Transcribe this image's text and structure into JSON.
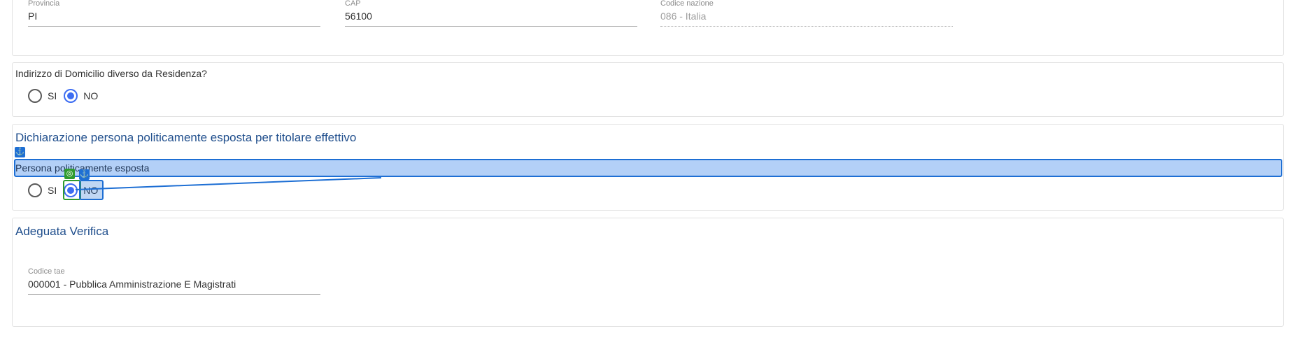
{
  "address": {
    "provincia": {
      "label": "Provincia",
      "value": "PI"
    },
    "cap": {
      "label": "CAP",
      "value": "56100"
    },
    "codice_nazione": {
      "label": "Codice nazione",
      "value": "086 - Italia"
    }
  },
  "domicilio": {
    "question": "Indirizzo di Domicilio diverso da Residenza?",
    "options": [
      "SI",
      "NO"
    ],
    "selected": "NO"
  },
  "pep": {
    "title": "Dichiarazione persona politicamente esposta per titolare effettivo",
    "question": "Persona politicamente esposta",
    "options": [
      "SI",
      "NO"
    ],
    "selected": "NO"
  },
  "adeguata_verifica": {
    "title": "Adeguata Verifica",
    "codice_tae": {
      "label": "Codice tae",
      "value": "000001 - Pubblica Amministrazione E Magistrati"
    }
  },
  "overlay": {
    "anchor_icon": "anchor-icon",
    "target_icon": "target-icon",
    "colors": {
      "highlight": "#b3d0f7",
      "highlight_border": "#1e6fd4",
      "target": "#2e9b2e"
    }
  }
}
